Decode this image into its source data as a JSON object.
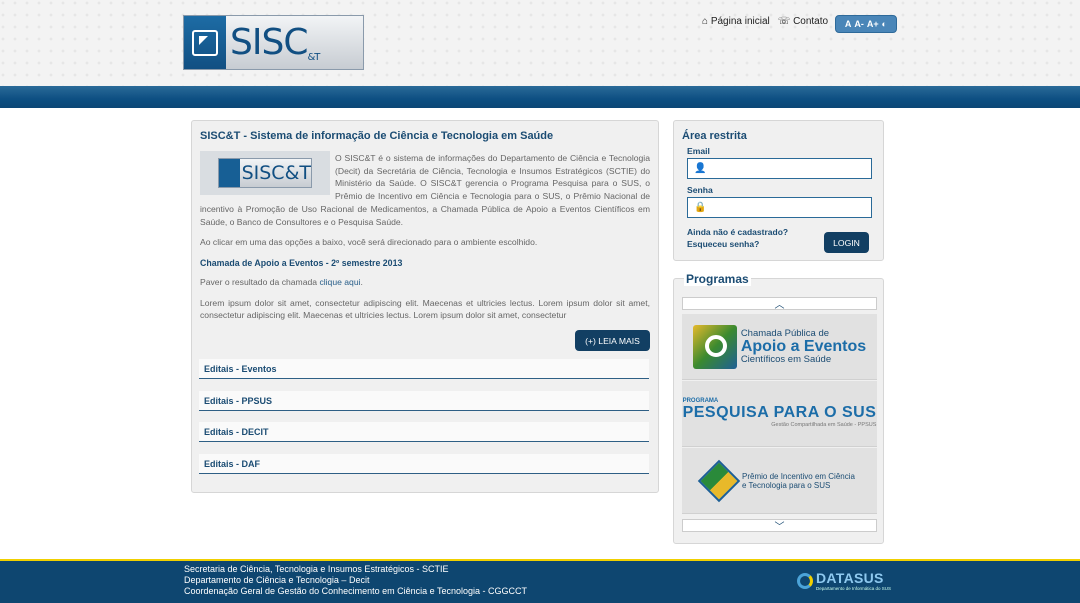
{
  "header": {
    "logo_text": "SISC",
    "logo_amp": "&T",
    "links": [
      {
        "icon": "home-icon",
        "label": "Página inicial"
      },
      {
        "icon": "phone-icon",
        "label": "Contato"
      }
    ],
    "font_controls": [
      "A",
      "A-",
      "A+",
      "◐"
    ]
  },
  "main": {
    "title": "SISC&T - Sistema de informação de Ciência e Tecnologia em Saúde",
    "thumb_text": "SISC&T",
    "description": "O SISC&T é o sistema de informações do Departamento de Ciência e Tecnologia (Decit) da Secretária de Ciência, Tecnologia e Insumos Estratégicos (SCTIE) do Ministério da Saúde. O SISC&T gerencia o Programa Pesquisa para o SUS, o Prêmio de Incentivo em Ciência e Tecnologia para o SUS, o Prêmio Nacional de incentivo à Promoção de Uso Racional de Medicamentos, a Chamada Pública de Apoio a Eventos Científicos em Saúde, o Banco de Consultores e o Pesquisa Saúde.",
    "intro": "Ao clicar em uma das opções a baixo, você será direcionado para o ambiente escolhido.",
    "subtitle": "Chamada de Apoio a Eventos - 2º semestre 2013",
    "result_prefix": "Paver o resultado da chamada",
    "result_link": "clique aqui",
    "result_suffix": ".",
    "lorem": "Lorem ipsum dolor sit amet, consectetur adipiscing elit. Maecenas et ultricies lectus. Lorem ipsum dolor sit amet, consectetur adipiscing elit. Maecenas et ultricies lectus. Lorem ipsum dolor sit amet, consectetur",
    "read_more": "(+) LEIA MAIS",
    "editais": [
      "Editais - Eventos",
      "Editais - PPSUS",
      "Editais - DECIT",
      "Editais - DAF"
    ]
  },
  "login": {
    "title": "Área restrita",
    "email_label": "Email",
    "password_label": "Senha",
    "register_link": "Ainda não é cadastrado?",
    "forgot_link": "Esqueceu senha?",
    "button": "LOGIN"
  },
  "programs": {
    "title": "Programas",
    "p1": {
      "line1": "Chamada Pública de",
      "line2": "Apoio a Eventos",
      "line3": "Científicos em Saúde"
    },
    "p2": {
      "top": "PROGRAMA",
      "main": "PESQUISA PARA O SUS",
      "bottom": "Gestão Compartilhada em Saúde - PPSUS"
    },
    "p3": {
      "line1": "Prêmio de Incentivo em Ciência",
      "line2": "e Tecnologia para o SUS"
    }
  },
  "footer": {
    "lines": [
      "Secretaria de Ciência, Tecnologia e Insumos Estratégicos - SCTIE",
      "Departamento de Ciência e Tecnologia – Decit",
      "Coordenação Geral de Gestão do Conhecimento em Ciência e Tecnologia - CGGCCT"
    ],
    "brand": "DATASUS",
    "brand_sub": "Departamento de Informática do SUS"
  }
}
